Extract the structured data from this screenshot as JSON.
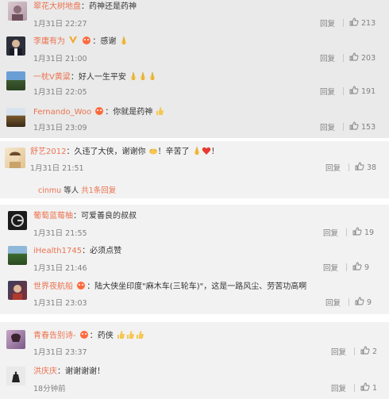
{
  "comments": [
    {
      "user": "翠花大树地盘",
      "text": "：药神还是药神",
      "time": "1月31日 22:27",
      "reply": "回复",
      "likes": "213"
    },
    {
      "user": "李庸有为",
      "text": "：感谢",
      "time": "1月31日 21:00",
      "reply": "回复",
      "likes": "203"
    },
    {
      "user": "一枕V黄粱",
      "text": "：好人一生平安",
      "time": "1月31日 22:05",
      "reply": "回复",
      "likes": "191"
    },
    {
      "user": "Fernando_Woo",
      "text": "：你就是药神",
      "time": "1月31日 23:09",
      "reply": "回复",
      "likes": "153"
    },
    {
      "user": "舒艺2012",
      "text": "：久违了大侠，谢谢你",
      "text2": "！辛苦了",
      "text3": "！",
      "time": "1月31日 21:51",
      "reply": "回复",
      "likes": "38"
    },
    {
      "user": "葡萄蓝莓柚",
      "text": "：可爱善良的叔叔",
      "time": "1月31日 21:55",
      "reply": "回复",
      "likes": "19"
    },
    {
      "user": "iHealth1745",
      "text": "：必须点赞",
      "time": "1月31日 21:46",
      "reply": "回复",
      "likes": "9"
    },
    {
      "user": "世界夜航船",
      "text": "：陆大侠坐印度\"麻木车(三轮车)\"，这是一路风尘、劳苦功高啊",
      "time": "1月31日 23:03",
      "reply": "回复",
      "likes": "9"
    },
    {
      "user": "青春告别诗-",
      "text": "：药侠",
      "time": "1月31日 23:37",
      "reply": "回复",
      "likes": "2"
    },
    {
      "user": "洪庆庆",
      "text": "：谢谢谢谢！",
      "time": "18分钟前",
      "reply": "回复",
      "likes": "1"
    }
  ],
  "subreply": {
    "user": "cinmu",
    "text": "等人",
    "link": "共1条回复"
  },
  "colors": {
    "username": "#eb7350",
    "meta": "#808080",
    "bg": "#f2f2f2"
  }
}
